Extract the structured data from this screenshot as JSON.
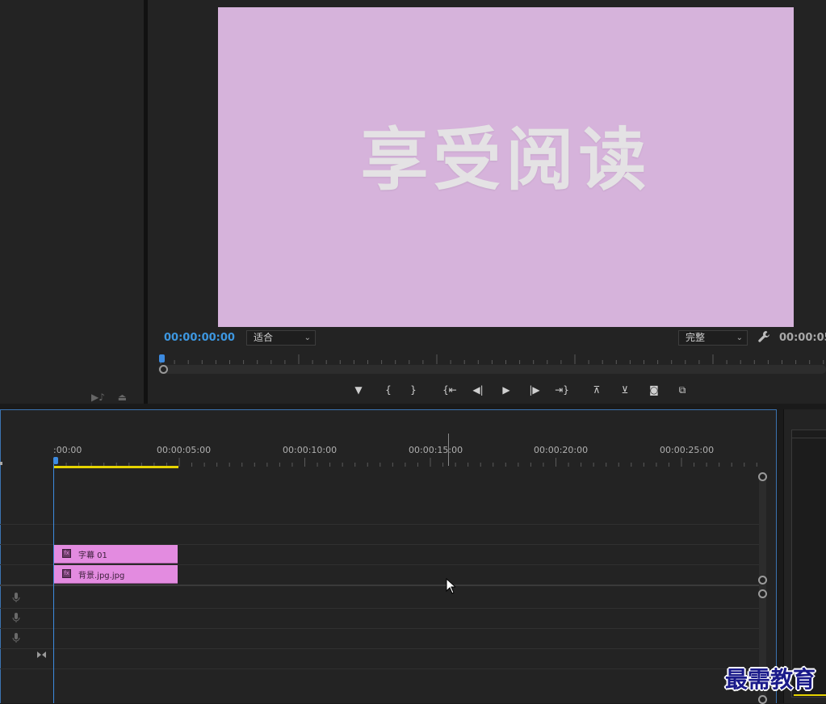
{
  "monitor": {
    "frame_text": "享受阅读",
    "timecode_current": "00:00:00:00",
    "zoom_value": "适合",
    "quality_value": "完整",
    "timecode_duration": "00:00:05:"
  },
  "controls": [
    {
      "name": "add-marker-button",
      "icon": "marker-icon",
      "glyph": "▼"
    },
    {
      "name": "mark-in-button",
      "icon": "mark-in-icon",
      "glyph": "{"
    },
    {
      "name": "mark-out-button",
      "icon": "mark-out-icon",
      "glyph": "}"
    },
    {
      "name": "go-to-in-button",
      "icon": "go-to-in-icon",
      "glyph": "{⇤"
    },
    {
      "name": "step-back-button",
      "icon": "step-back-icon",
      "glyph": "◀|"
    },
    {
      "name": "play-button",
      "icon": "play-icon",
      "glyph": "▶"
    },
    {
      "name": "step-forward-button",
      "icon": "step-forward-icon",
      "glyph": "|▶"
    },
    {
      "name": "go-to-out-button",
      "icon": "go-to-out-icon",
      "glyph": "⇥}"
    },
    {
      "name": "lift-button",
      "icon": "lift-icon",
      "glyph": "⊼"
    },
    {
      "name": "extract-button",
      "icon": "extract-icon",
      "glyph": "⊻"
    },
    {
      "name": "export-frame-button",
      "icon": "camera-icon",
      "glyph": "◙"
    },
    {
      "name": "comparison-view-button",
      "icon": "comparison-icon",
      "glyph": "⧉"
    }
  ],
  "timeline": {
    "ruler_labels": [
      ":00:00",
      "00:00:05:00",
      "00:00:10:00",
      "00:00:15:00",
      "00:00:20:00",
      "00:00:25:00"
    ],
    "clips": [
      {
        "label": "字幕 01",
        "fx_icon": "fx-icon"
      },
      {
        "label": "背景.jpg.jpg",
        "fx_icon": "fx-icon"
      }
    ]
  },
  "watermark": "最需教育",
  "colors": {
    "accent": "#3d97e0",
    "frame_background": "#d6b3db",
    "clip": "#e38be0",
    "work_area": "#e6d400"
  }
}
